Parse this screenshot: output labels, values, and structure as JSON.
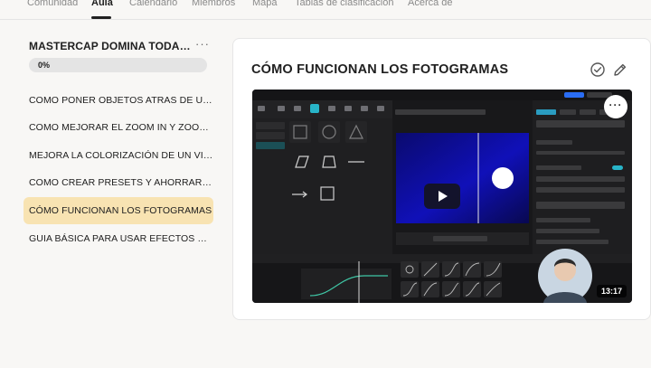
{
  "nav": {
    "tabs": [
      {
        "label": "Comunidad"
      },
      {
        "label": "Aula"
      },
      {
        "label": "Calendario"
      },
      {
        "label": "Miembros"
      },
      {
        "label": "Mapa"
      },
      {
        "label": "Tablas de clasificación"
      },
      {
        "label": "Acerca de"
      }
    ],
    "active": "Aula"
  },
  "course": {
    "title": "MASTERCAP DOMINA TODAS LAS HERRAMIENTAS",
    "more": "···",
    "progress_label": "0%",
    "progress": 0
  },
  "lessons": [
    {
      "label": "COMO PONER OBJETOS ATRAS DE UNA PERSONA"
    },
    {
      "label": "COMO MEJORAR EL ZOOM IN Y ZOOM OUT"
    },
    {
      "label": "MEJORA LA COLORIZACIÓN DE UN VIDEO"
    },
    {
      "label": "COMO CREAR PRESETS Y AHORRAR TIEMPO"
    },
    {
      "label": "CÓMO FUNCIONAN LOS FOTOGRAMAS"
    },
    {
      "label": "GUIA BÁSICA PARA USAR EFECTOS DE SONIDO"
    }
  ],
  "active_lesson": 4,
  "lesson": {
    "title": "CÓMO FUNCIONAN LOS FOTOGRAMAS",
    "video_duration": "13:17",
    "video_more": "···"
  },
  "colors": {
    "active_lesson_bg": "#f8e3b2",
    "page_bg": "#f8f7f5"
  }
}
